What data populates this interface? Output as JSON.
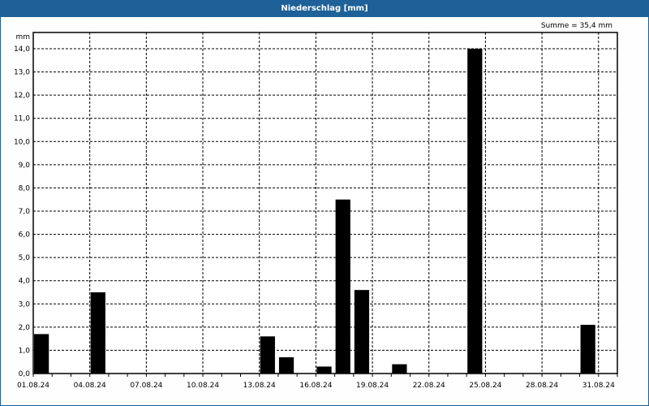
{
  "window": {
    "title": "Niederschlag [mm]"
  },
  "chart_data": {
    "type": "bar",
    "title": "Niederschlag [mm]",
    "ylabel": "mm",
    "xlabel": "",
    "annotation": "Summe = 35,4 mm",
    "ylim": [
      0,
      14.7
    ],
    "yticks": [
      "0,0",
      "1,0",
      "2,0",
      "3,0",
      "4,0",
      "5,0",
      "6,0",
      "7,0",
      "8,0",
      "9,0",
      "10,0",
      "11,0",
      "12,0",
      "13,0",
      "14,0"
    ],
    "x_range_days": [
      1,
      32
    ],
    "xticks": [
      {
        "day": 1,
        "label": "01.08.24"
      },
      {
        "day": 4,
        "label": "04.08.24"
      },
      {
        "day": 7,
        "label": "07.08.24"
      },
      {
        "day": 10,
        "label": "10.08.24"
      },
      {
        "day": 13,
        "label": "13.08.24"
      },
      {
        "day": 16,
        "label": "16.08.24"
      },
      {
        "day": 19,
        "label": "19.08.24"
      },
      {
        "day": 22,
        "label": "22.08.24"
      },
      {
        "day": 25,
        "label": "25.08.24"
      },
      {
        "day": 28,
        "label": "28.08.24"
      },
      {
        "day": 31,
        "label": "31.08.24"
      }
    ],
    "grid": true,
    "bar_color": "#000000",
    "bars": [
      {
        "day": 1,
        "value": 1.7
      },
      {
        "day": 4,
        "value": 3.5
      },
      {
        "day": 13,
        "value": 1.6
      },
      {
        "day": 14,
        "value": 0.7
      },
      {
        "day": 16,
        "value": 0.3
      },
      {
        "day": 17,
        "value": 7.5
      },
      {
        "day": 18,
        "value": 3.6
      },
      {
        "day": 20,
        "value": 0.4
      },
      {
        "day": 24,
        "value": 14.0
      },
      {
        "day": 30,
        "value": 2.1
      }
    ]
  }
}
